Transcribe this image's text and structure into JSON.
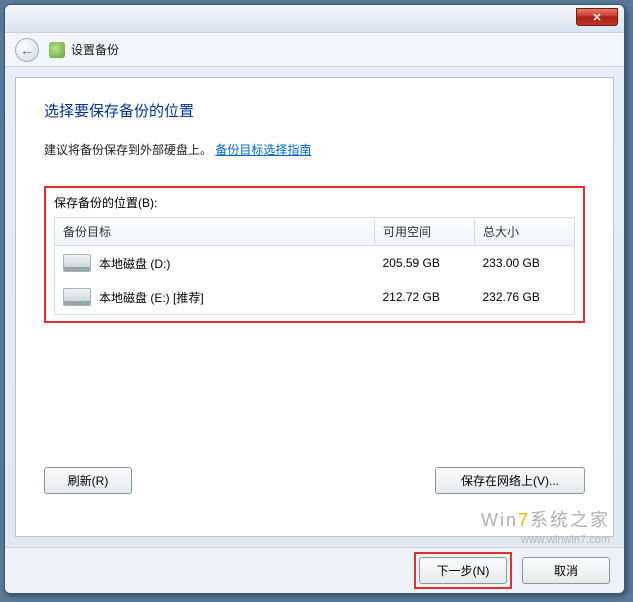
{
  "nav": {
    "title": "设置备份"
  },
  "page": {
    "heading": "选择要保存备份的位置",
    "advice_prefix": "建议将备份保存到外部硬盘上。",
    "advice_link": "备份目标选择指南",
    "location_label": "保存备份的位置(B):"
  },
  "columns": {
    "target": "备份目标",
    "free": "可用空间",
    "total": "总大小"
  },
  "drives": [
    {
      "name": "本地磁盘 (D:)",
      "free": "205.59 GB",
      "total": "233.00 GB"
    },
    {
      "name": "本地磁盘 (E:) [推荐]",
      "free": "212.72 GB",
      "total": "232.76 GB"
    }
  ],
  "buttons": {
    "refresh": "刷新(R)",
    "save_network": "保存在网络上(V)...",
    "next": "下一步(N)",
    "cancel": "取消"
  },
  "watermark": {
    "brand_prefix": "Win",
    "brand_accent": "7",
    "brand_suffix": "系统之家",
    "url": "www.winwin7.com"
  }
}
